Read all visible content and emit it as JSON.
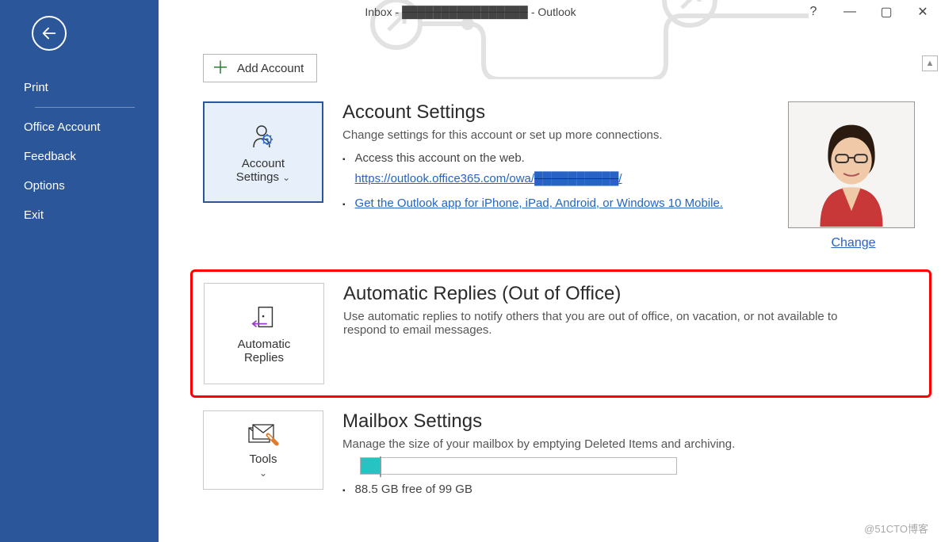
{
  "titlebar": {
    "prefix": "Inbox -",
    "email_redacted": "████████████████",
    "suffix": "-  Outlook",
    "controls": {
      "help": "?",
      "minimize": "—",
      "maximize": "▢",
      "close": "✕"
    }
  },
  "sidebar": {
    "items": [
      "Print",
      "Office Account",
      "Feedback",
      "Options",
      "Exit"
    ]
  },
  "add_account": {
    "label": "Add Account"
  },
  "account_settings": {
    "tile_line1": "Account",
    "tile_line2": "Settings",
    "title": "Account Settings",
    "sub": "Change settings for this account or set up more connections.",
    "bullets": {
      "b1_text": "Access this account on the web.",
      "b1_link_prefix": "https://outlook.office365.com/owa/",
      "b1_link_redacted": "██████████",
      "b1_link_slash": "/",
      "b2_link": "Get the Outlook app for iPhone, iPad, Android, or Windows 10 Mobile."
    },
    "change": "Change"
  },
  "auto_replies": {
    "tile_line1": "Automatic",
    "tile_line2": "Replies",
    "title": "Automatic Replies (Out of Office)",
    "sub": "Use automatic replies to notify others that you are out of office, on vacation, or not available to respond to email messages."
  },
  "mailbox": {
    "tile_line1": "Tools",
    "title": "Mailbox Settings",
    "sub": "Manage the size of your mailbox by emptying Deleted Items and archiving.",
    "quota_text": "88.5 GB free of 99 GB"
  },
  "watermark": "@51CTO博客"
}
